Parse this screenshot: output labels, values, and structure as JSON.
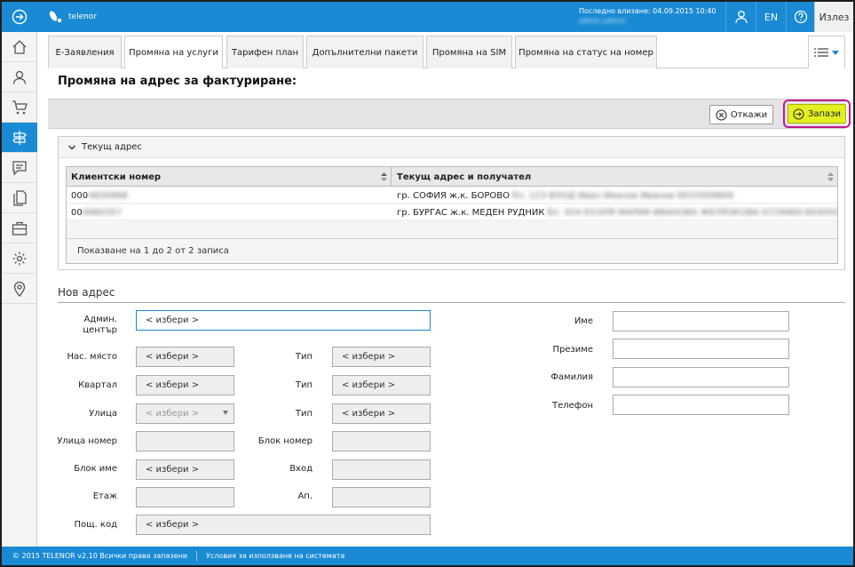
{
  "topbar": {
    "brand": "telenor",
    "last_login_label": "Последно влизане: 04.09.2015 10:40",
    "last_login_user": "admin.admin",
    "lang": "EN",
    "exit_label": "Излез"
  },
  "tabs": [
    {
      "label": "Е-Заявления"
    },
    {
      "label": "Промяна на услуги"
    },
    {
      "label": "Тарифен план"
    },
    {
      "label": "Допълнителни пакети"
    },
    {
      "label": "Промяна на SIM"
    },
    {
      "label": "Промяна на статус на номер"
    }
  ],
  "page_title": "Промяна на адрес за фактуриране:",
  "actions": {
    "cancel": "Откажи",
    "save": "Запази"
  },
  "current_address": {
    "heading": "Текущ адрес",
    "columns": [
      "Клиентски номер",
      "Текущ адрес и получател"
    ],
    "rows": [
      {
        "client": "000",
        "client_hidden": "4620968",
        "address": "гр. СОФИЯ ж.к. БОРОВО",
        "address_hidden": "бл. 123 ВХОД Иван Иванов Иванов 0032009809"
      },
      {
        "client": "00",
        "client_hidden": "0960357",
        "address": "гр. БУРГАС ж.к. МЕДЕН РУДНИК",
        "address_hidden": "бл. 424 ЕОЗЛЯ МАРИЯ ИВАНОВА ЖЕЛЯЗКОВА 0729969-893050"
      }
    ],
    "footer": "Показване на 1 до 2 от 2 записа"
  },
  "new_address": {
    "heading": "Нов адрес",
    "select_placeholder": "< избери >",
    "labels": {
      "admin_center": "Админ. център",
      "settlement": "Нас. място",
      "quarter": "Квартал",
      "street": "Улица",
      "street_no": "Улица номер",
      "block_name": "Блок име",
      "floor": "Етаж",
      "postcode": "Пощ. код",
      "type1": "Тип",
      "type2": "Тип",
      "type3": "Тип",
      "block_no": "Блок номер",
      "entrance": "Вход",
      "apt": "Ап.",
      "first_name": "Име",
      "middle_name": "Презиме",
      "last_name": "Фамилия",
      "phone": "Телефон"
    }
  },
  "footer": {
    "copyright": "© 2015 TELENOR v2.10 Всички права запазени",
    "terms": "Условия за използване на системата"
  },
  "colors": {
    "brand_blue": "#1a8ad4",
    "save_yellow": "#e3f020",
    "highlight_magenta": "#c0148c"
  }
}
